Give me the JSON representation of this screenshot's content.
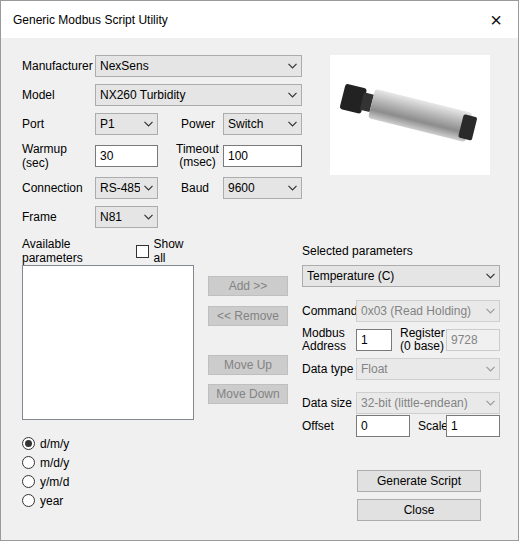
{
  "window": {
    "title": "Generic Modbus Script Utility",
    "close": "×"
  },
  "device": {
    "manufacturer": {
      "label": "Manufacturer",
      "value": "NexSens"
    },
    "model": {
      "label": "Model",
      "value": "NX260 Turbidity"
    },
    "port": {
      "label": "Port",
      "value": "P1"
    },
    "power": {
      "label": "Power",
      "value": "Switch"
    },
    "warmup": {
      "label": "Warmup (sec)",
      "value": "30"
    },
    "timeout": {
      "label": "Timeout (msec)",
      "value": "100"
    },
    "connection": {
      "label": "Connection",
      "value": "RS-485"
    },
    "baud": {
      "label": "Baud",
      "value": "9600"
    },
    "frame": {
      "label": "Frame",
      "value": "N81"
    }
  },
  "available": {
    "label": "Available parameters",
    "items": [],
    "show_all": {
      "label": "Show all",
      "checked": false
    }
  },
  "list_buttons": [
    {
      "label": "Add >>",
      "disabled": true
    },
    {
      "label": "<< Remove",
      "disabled": true
    },
    {
      "label": "Move Up",
      "disabled": true
    },
    {
      "label": "Move Down",
      "disabled": true
    }
  ],
  "date_formats": [
    {
      "label": "d/m/y",
      "selected": true
    },
    {
      "label": "m/d/y",
      "selected": false
    },
    {
      "label": "y/m/d",
      "selected": false
    },
    {
      "label": "year",
      "selected": false
    }
  ],
  "selected": {
    "label": "Selected parameters",
    "parameter": "Temperature (C)",
    "command": {
      "label": "Command",
      "value": "0x03 (Read Holding)",
      "disabled": true
    },
    "modbus_address": {
      "label": "Modbus Address",
      "value": "1",
      "disabled": false
    },
    "register": {
      "label": "Register (0 base)",
      "value": "9728",
      "disabled": true
    },
    "data_type": {
      "label": "Data type",
      "value": "Float",
      "disabled": true
    },
    "data_size": {
      "label": "Data size",
      "value": "32-bit (little-endean)",
      "disabled": true
    },
    "offset": {
      "label": "Offset",
      "value": "0",
      "disabled": false
    },
    "scale": {
      "label": "Scale",
      "value": "1",
      "disabled": false
    }
  },
  "buttons": [
    "Generate Script",
    "Close"
  ]
}
